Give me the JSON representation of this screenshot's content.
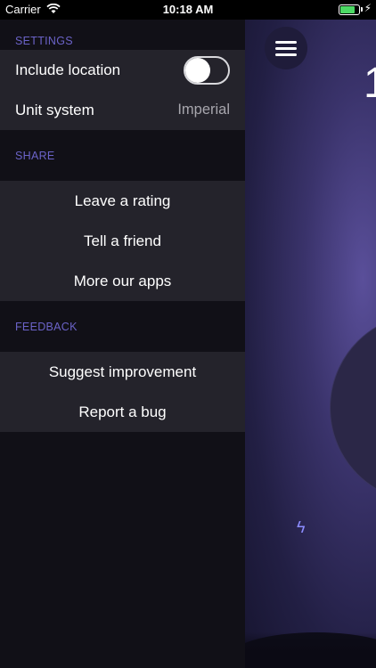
{
  "status_bar": {
    "carrier": "Carrier",
    "time": "10:18 AM",
    "battery_level": 0.9,
    "battery_color": "#4cd964"
  },
  "menu": {
    "settings": {
      "header": "SETTINGS",
      "include_location_label": "Include location",
      "include_location_enabled": false,
      "unit_system_label": "Unit system",
      "unit_system_value": "Imperial"
    },
    "share": {
      "header": "SHARE",
      "items": [
        "Leave a rating",
        "Tell a friend",
        "More our apps"
      ]
    },
    "feedback": {
      "header": "FEEDBACK",
      "items": [
        "Suggest improvement",
        "Report a bug"
      ]
    }
  },
  "background": {
    "partial_text": "1",
    "accent_color": "#6b63c8"
  }
}
